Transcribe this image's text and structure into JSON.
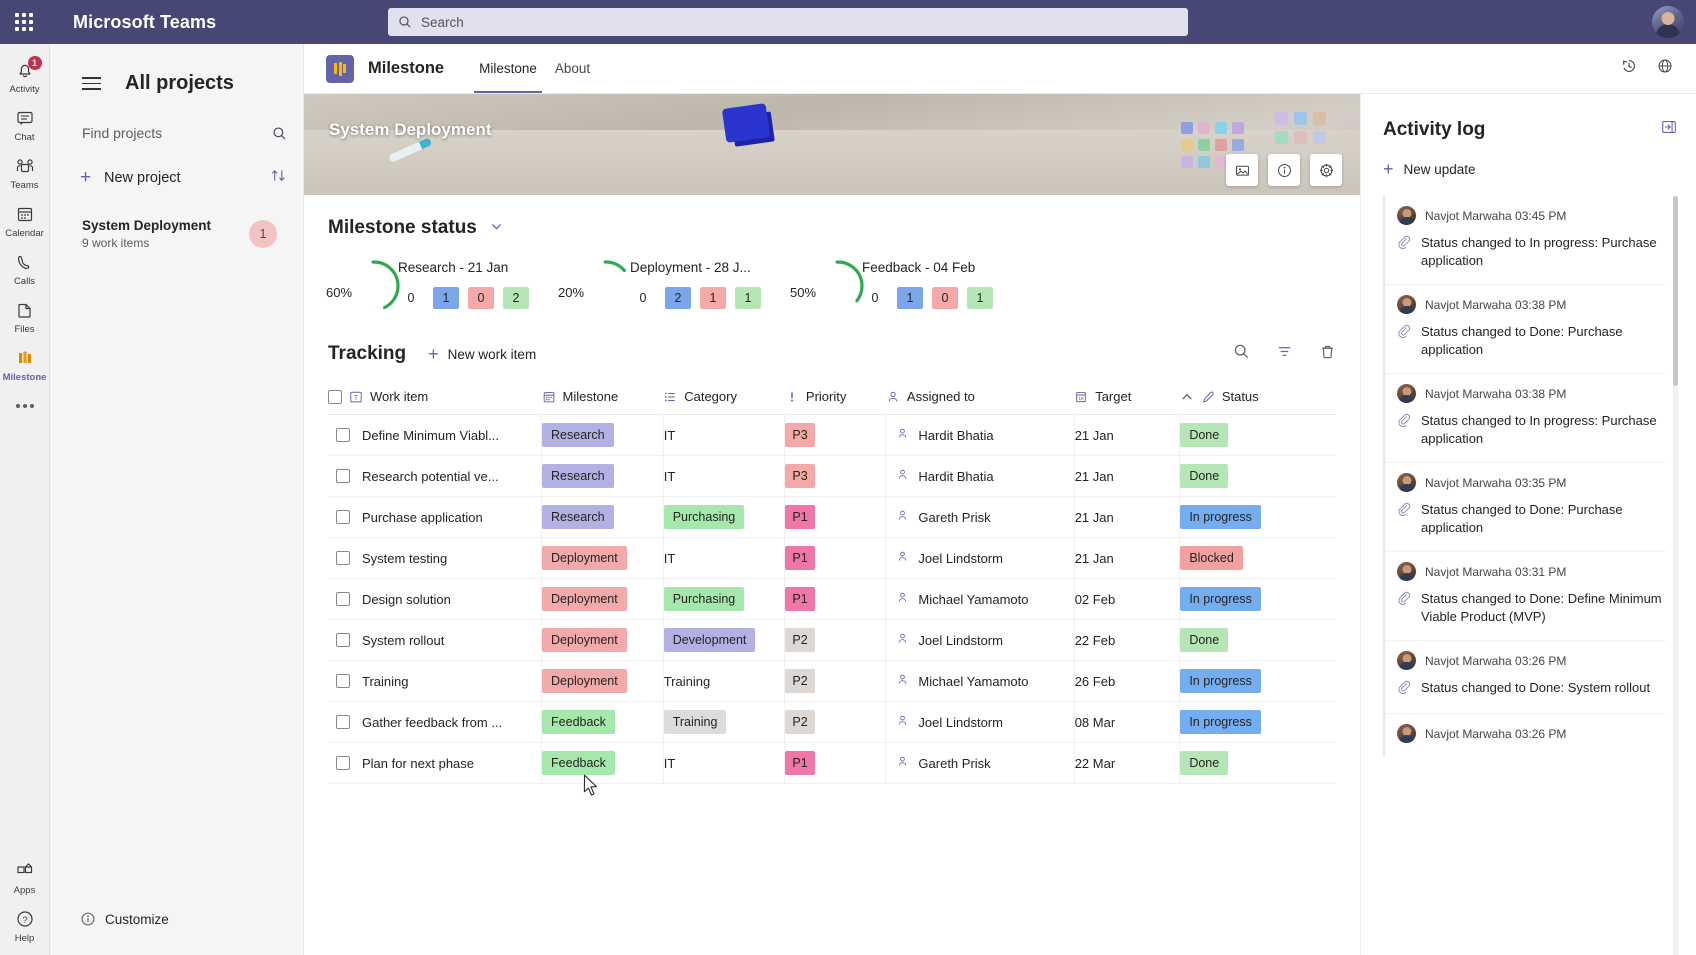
{
  "titlebar": {
    "brand": "Microsoft Teams",
    "search_placeholder": "Search",
    "waffle_icon": "app-launcher-icon",
    "search_icon": "search-icon",
    "avatar_icon": "user-avatar"
  },
  "rail": {
    "items": [
      {
        "label": "Activity",
        "icon": "bell-icon",
        "badge": "1"
      },
      {
        "label": "Chat",
        "icon": "chat-icon",
        "badge": ""
      },
      {
        "label": "Teams",
        "icon": "teams-icon",
        "badge": ""
      },
      {
        "label": "Calendar",
        "icon": "calendar-icon",
        "badge": ""
      },
      {
        "label": "Calls",
        "icon": "phone-icon",
        "badge": ""
      },
      {
        "label": "Files",
        "icon": "files-icon",
        "badge": ""
      },
      {
        "label": "Milestone",
        "icon": "milestone-icon",
        "badge": ""
      }
    ],
    "more_icon": "more-horizontal-icon",
    "bottom": [
      {
        "label": "Apps",
        "icon": "apps-icon"
      },
      {
        "label": "Help",
        "icon": "help-icon"
      }
    ]
  },
  "sidebar": {
    "title": "All projects",
    "menu_icon": "hamburger-icon",
    "find_placeholder": "Find projects",
    "find_icon": "search-icon",
    "new_project_label": "New project",
    "sort_icon": "sort-icon",
    "project": {
      "name": "System Deployment",
      "subtitle": "9 work items",
      "count": "1"
    },
    "customize_label": "Customize",
    "customize_icon": "info-icon"
  },
  "tabbar": {
    "app_name": "Milestone",
    "app_icon": "milestone-app-icon",
    "tabs": [
      {
        "label": "Milestone",
        "selected": true
      },
      {
        "label": "About",
        "selected": false
      }
    ],
    "right_icons": [
      "history-icon",
      "globe-icon"
    ]
  },
  "hero": {
    "title": "System Deployment",
    "buttons": [
      "image-icon",
      "info-icon",
      "gear-icon"
    ]
  },
  "milestone_status": {
    "heading": "Milestone status",
    "chevron_icon": "chevron-down-icon",
    "cards": [
      {
        "percent": "60%",
        "percent_value": 60,
        "name": "Research - 21 Jan",
        "counts": [
          {
            "value": "0",
            "color": "transparent"
          },
          {
            "value": "1",
            "color": "#7ba7ea"
          },
          {
            "value": "0",
            "color": "#f3a9a9"
          },
          {
            "value": "2",
            "color": "#b6e6b6"
          }
        ]
      },
      {
        "percent": "20%",
        "percent_value": 20,
        "name": "Deployment - 28 J...",
        "counts": [
          {
            "value": "0",
            "color": "transparent"
          },
          {
            "value": "2",
            "color": "#7ba7ea"
          },
          {
            "value": "1",
            "color": "#f3a9a9"
          },
          {
            "value": "1",
            "color": "#b6e6b6"
          }
        ]
      },
      {
        "percent": "50%",
        "percent_value": 50,
        "name": "Feedback - 04 Feb",
        "counts": [
          {
            "value": "0",
            "color": "transparent"
          },
          {
            "value": "1",
            "color": "#7ba7ea"
          },
          {
            "value": "0",
            "color": "#f3a9a9"
          },
          {
            "value": "1",
            "color": "#b6e6b6"
          }
        ]
      }
    ]
  },
  "tracking": {
    "heading": "Tracking",
    "new_item_label": "New work item",
    "tools": [
      "search-icon",
      "filter-icon",
      "delete-icon"
    ],
    "columns": [
      {
        "label": "Work item",
        "icon": "text-field-icon"
      },
      {
        "label": "Milestone",
        "icon": "calendar-icon"
      },
      {
        "label": "Category",
        "icon": "list-icon"
      },
      {
        "label": "Priority",
        "icon": "priority-icon"
      },
      {
        "label": "Assigned to",
        "icon": "person-icon"
      },
      {
        "label": "Target",
        "icon": "date-icon"
      },
      {
        "label": "Status",
        "icon": "pencil-icon"
      }
    ],
    "sort_indicator_icon": "chevron-up-icon",
    "rows": [
      {
        "work_item": "Define Minimum Viabl...",
        "milestone": "Research",
        "milestone_color": "#b3b0e3",
        "category": "IT",
        "category_color": "transparent",
        "priority": "P3",
        "priority_color": "#f5a8a8",
        "assigned_to": "Hardit Bhatia",
        "target": "21 Jan",
        "status": "Done",
        "status_color": "#b6e6b6"
      },
      {
        "work_item": "Research potential ve...",
        "milestone": "Research",
        "milestone_color": "#b3b0e3",
        "category": "IT",
        "category_color": "transparent",
        "priority": "P3",
        "priority_color": "#f5a8a8",
        "assigned_to": "Hardit Bhatia",
        "target": "21 Jan",
        "status": "Done",
        "status_color": "#b6e6b6"
      },
      {
        "work_item": "Purchase application",
        "milestone": "Research",
        "milestone_color": "#b3b0e3",
        "category": "Purchasing",
        "category_color": "#a6e8ab",
        "priority": "P1",
        "priority_color": "#f075a8",
        "assigned_to": "Gareth Prisk",
        "target": "21 Jan",
        "status": "In progress",
        "status_color": "#74aef0"
      },
      {
        "work_item": "System testing",
        "milestone": "Deployment",
        "milestone_color": "#f2a9a9",
        "category": "IT",
        "category_color": "transparent",
        "priority": "P1",
        "priority_color": "#f075a8",
        "assigned_to": "Joel Lindstorm",
        "target": "21 Jan",
        "status": "Blocked",
        "status_color": "#f2a0a0"
      },
      {
        "work_item": "Design solution",
        "milestone": "Deployment",
        "milestone_color": "#f2a9a9",
        "category": "Purchasing",
        "category_color": "#a6e8ab",
        "priority": "P1",
        "priority_color": "#f075a8",
        "assigned_to": "Michael Yamamoto",
        "target": "02 Feb",
        "status": "In progress",
        "status_color": "#74aef0"
      },
      {
        "work_item": "System rollout",
        "milestone": "Deployment",
        "milestone_color": "#f2a9a9",
        "category": "Development",
        "category_color": "#b3b0e3",
        "priority": "P2",
        "priority_color": "#ddd8d4",
        "assigned_to": "Joel Lindstorm",
        "target": "22 Feb",
        "status": "Done",
        "status_color": "#b6e6b6"
      },
      {
        "work_item": "Training",
        "milestone": "Deployment",
        "milestone_color": "#f2a9a9",
        "category": "Training",
        "category_color": "transparent",
        "priority": "P2",
        "priority_color": "#ddd8d4",
        "assigned_to": "Michael Yamamoto",
        "target": "26 Feb",
        "status": "In progress",
        "status_color": "#74aef0"
      },
      {
        "work_item": "Gather feedback from ...",
        "milestone": "Feedback",
        "milestone_color": "#a6e8ab",
        "category": "Training",
        "category_color": "#dedcdb",
        "priority": "P2",
        "priority_color": "#ddd8d4",
        "assigned_to": "Joel Lindstorm",
        "target": "08 Mar",
        "status": "In progress",
        "status_color": "#74aef0"
      },
      {
        "work_item": "Plan for next phase",
        "milestone": "Feedback",
        "milestone_color": "#a6e8ab",
        "category": "IT",
        "category_color": "transparent",
        "priority": "P1",
        "priority_color": "#f075a8",
        "assigned_to": "Gareth Prisk",
        "target": "22 Mar",
        "status": "Done",
        "status_color": "#b6e6b6"
      }
    ]
  },
  "activity_log": {
    "heading": "Activity log",
    "expand_icon": "expand-panel-icon",
    "new_update_label": "New update",
    "entries": [
      {
        "author": "Navjot Marwaha",
        "time": "03:45 PM",
        "message": "Status changed to In progress: Purchase application"
      },
      {
        "author": "Navjot Marwaha",
        "time": "03:38 PM",
        "message": "Status changed to Done: Purchase application"
      },
      {
        "author": "Navjot Marwaha",
        "time": "03:38 PM",
        "message": "Status changed to In progress: Purchase application"
      },
      {
        "author": "Navjot Marwaha",
        "time": "03:35 PM",
        "message": "Status changed to Done: Purchase application"
      },
      {
        "author": "Navjot Marwaha",
        "time": "03:31 PM",
        "message": "Status changed to Done: Define Minimum Viable Product (MVP)"
      },
      {
        "author": "Navjot Marwaha",
        "time": "03:26 PM",
        "message": "Status changed to Done: System rollout"
      },
      {
        "author": "Navjot Marwaha",
        "time": "03:26 PM",
        "message": ""
      }
    ]
  },
  "theme": {
    "teams_purple": "#464775",
    "accent": "#6264a7",
    "badge_red": "#c4314b",
    "gauge_green": "#2eab4f"
  }
}
